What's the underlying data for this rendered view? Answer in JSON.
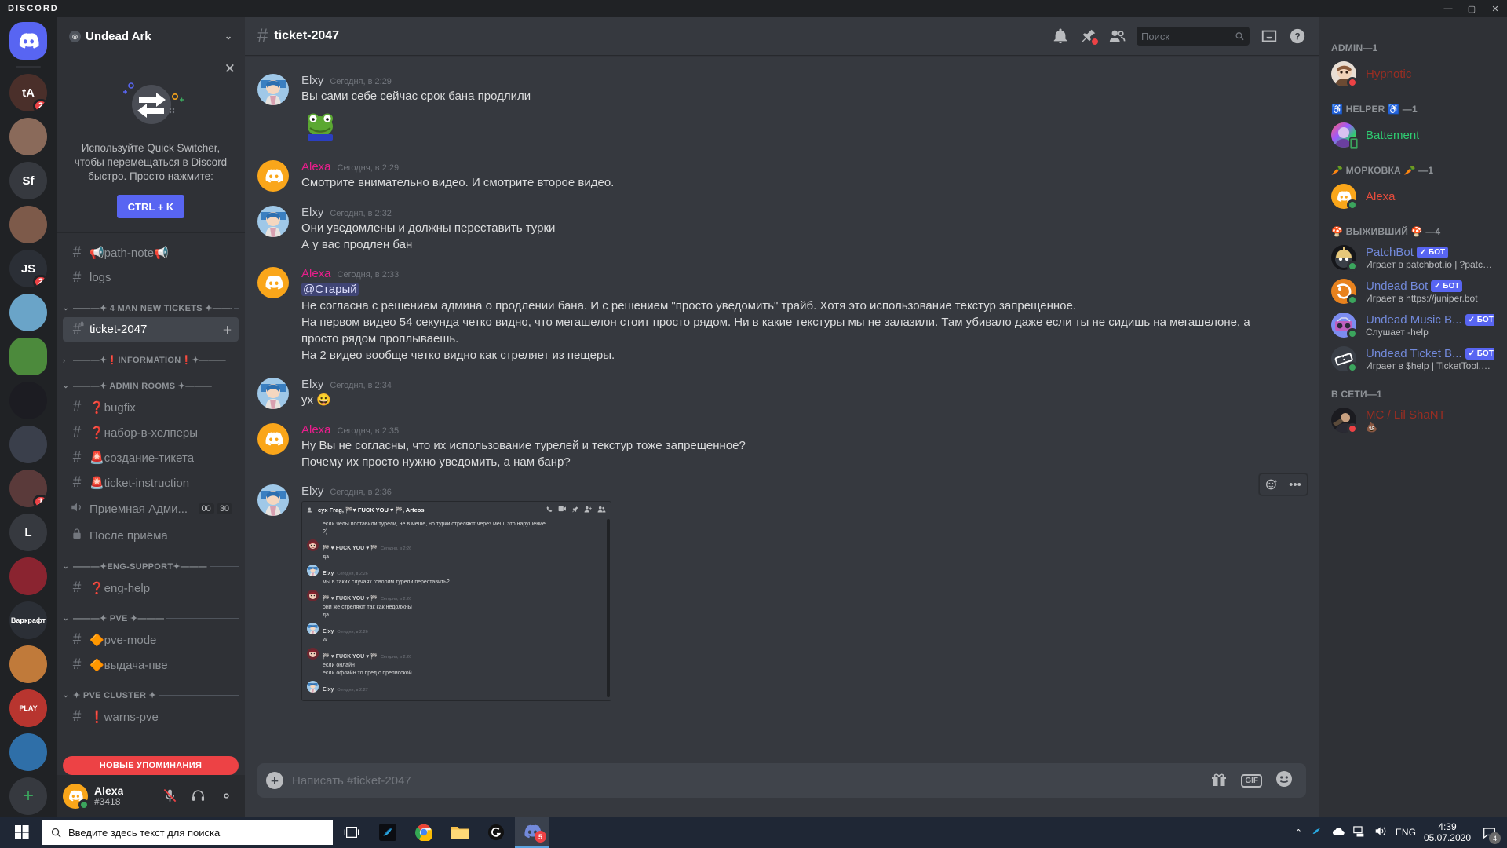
{
  "window": {
    "app_name": "DISCORD",
    "minimize": "—",
    "maximize": "▢",
    "close": "✕"
  },
  "guild_rail": {
    "home_label": "",
    "items": [
      {
        "name": "guild-undead-ark",
        "initials": "tA",
        "badge": "2",
        "selected": false,
        "color": "#4a2f2a"
      },
      {
        "name": "guild-anime",
        "initials": "",
        "badge": "",
        "selected": false,
        "color": "#8a6a5a"
      },
      {
        "name": "guild-sf",
        "initials": "Sf",
        "badge": "",
        "selected": false,
        "color": "#36393f"
      },
      {
        "name": "guild-photo",
        "initials": "",
        "badge": "",
        "selected": false,
        "color": "#7d5a4a"
      },
      {
        "name": "guild-js",
        "initials": "JS",
        "badge": "2",
        "selected": false,
        "color": "#2b2f36"
      },
      {
        "name": "guild-flower",
        "initials": "",
        "badge": "",
        "selected": false,
        "color": "#6aa4c8"
      },
      {
        "name": "guild-pepe",
        "initials": "",
        "badge": "",
        "selected": true,
        "color": "#4c8a3c"
      },
      {
        "name": "guild-dark",
        "initials": "",
        "badge": "",
        "selected": false,
        "color": "#1c1c22"
      },
      {
        "name": "guild-diamond",
        "initials": "",
        "badge": "",
        "selected": false,
        "color": "#3a3f4b"
      },
      {
        "name": "guild-skull",
        "initials": "",
        "badge": "1",
        "selected": false,
        "color": "#5a3a3a"
      },
      {
        "name": "guild-l",
        "initials": "L",
        "badge": "",
        "selected": false,
        "color": "#36393f"
      },
      {
        "name": "guild-red",
        "initials": "",
        "badge": "",
        "selected": false,
        "color": "#8a2430"
      },
      {
        "name": "guild-warcraft",
        "initials": "Варкрафт",
        "badge": "",
        "selected": false,
        "color": "#2b2f36"
      },
      {
        "name": "guild-orange",
        "initials": "",
        "badge": "",
        "selected": false,
        "color": "#c07a3a"
      },
      {
        "name": "guild-play",
        "initials": "PLAY",
        "badge": "",
        "selected": false,
        "color": "#b8352f"
      },
      {
        "name": "guild-spiral",
        "initials": "",
        "badge": "",
        "selected": false,
        "color": "#2f6fa8"
      }
    ],
    "add_server": "+"
  },
  "sidebar": {
    "guild_name": "Undead Ark",
    "chevron": "⌄",
    "promo": {
      "close": "✕",
      "text": "Используйте Quick Switcher, чтобы перемещаться в Discord быстро. Просто нажмите:",
      "button": "CTRL + K"
    },
    "groups": [
      {
        "name": "",
        "collapsed": false,
        "channels": [
          {
            "label": "📢path-note📢",
            "type": "text",
            "active": false,
            "locked": false
          },
          {
            "label": "logs",
            "type": "text",
            "active": false,
            "locked": false
          }
        ]
      },
      {
        "name": "———✦ 4 MAN NEW TICKETS ✦———",
        "collapsed": false,
        "channels": [
          {
            "label": "ticket-2047",
            "type": "text",
            "active": true,
            "locked": true,
            "action": "＋"
          }
        ]
      },
      {
        "name": "———✦❗INFORMATION❗✦———",
        "collapsed": true,
        "channels": []
      },
      {
        "name": "———✦ ADMIN ROOMS ✦———",
        "collapsed": false,
        "channels": [
          {
            "label": "❓bugfix",
            "type": "text",
            "active": false,
            "locked": false
          },
          {
            "label": "❓набор-в-хелперы",
            "type": "text",
            "active": false,
            "locked": false
          },
          {
            "label": "🚨создание-тикета",
            "type": "text",
            "active": false,
            "locked": false
          },
          {
            "label": "🚨ticket-instruction",
            "type": "text",
            "active": false,
            "locked": false
          },
          {
            "label": "Приемная Адми...",
            "type": "voice",
            "active": false,
            "counts": [
              "00",
              "30"
            ]
          },
          {
            "label": "После приёма",
            "type": "locked",
            "active": false
          }
        ]
      },
      {
        "name": "———✦ENG-SUPPORT✦———",
        "collapsed": false,
        "channels": [
          {
            "label": "❓eng-help",
            "type": "text",
            "active": false,
            "locked": false
          }
        ]
      },
      {
        "name": "———✦ PVE ✦———",
        "collapsed": false,
        "channels": [
          {
            "label": "🔶pve-mode",
            "type": "text",
            "active": false,
            "locked": false
          },
          {
            "label": "🔶выдача-пве",
            "type": "text",
            "active": false,
            "locked": false
          }
        ]
      },
      {
        "name": "✦ PVE CLUSTER ✦",
        "collapsed": false,
        "channels": [
          {
            "label": "❗warns-pve",
            "type": "text",
            "active": false,
            "locked": false
          }
        ]
      }
    ],
    "mention_banner": "НОВЫЕ УПОМИНАНИЯ",
    "user": {
      "name": "Alexa",
      "tag": "#3418",
      "mic_icon": "mic-muted-icon",
      "headset_icon": "headset-icon",
      "settings_icon": "gear-icon"
    }
  },
  "chat_header": {
    "channel": "ticket-2047",
    "icons": [
      "bell-icon",
      "pin-icon",
      "members-icon",
      "inbox-icon",
      "help-icon"
    ]
  },
  "search": {
    "placeholder": "Поиск",
    "value": "",
    "icon": "search-icon"
  },
  "messages": [
    {
      "author": "Elxy",
      "color": "#c7c9ce",
      "time": "Сегодня, в 2:29",
      "avatar": "elxy",
      "lines": [
        "Вы сами себе сейчас срок бана продлили"
      ],
      "sticker": "pepe"
    },
    {
      "author": "Alexa",
      "color": "#e91e8c",
      "time": "Сегодня, в 2:29",
      "avatar": "alexa",
      "lines": [
        "Смотрите внимательно видео. И смотрите второе видео."
      ]
    },
    {
      "author": "Elxy",
      "color": "#c7c9ce",
      "time": "Сегодня, в 2:32",
      "avatar": "elxy",
      "lines": [
        "Они уведомлены и должны переставить турки",
        "А у вас продлен бан"
      ]
    },
    {
      "author": "Alexa",
      "color": "#e91e8c",
      "time": "Сегодня, в 2:33",
      "avatar": "alexa",
      "mention": "@Старый",
      "lines": [
        "Не согласна с решением админа о продлении бана. И с решением \"просто уведомить\" трайб. Хотя это использование текстур запрещенное.",
        "На первом видео 54 секунда четко видно, что мегашелон стоит просто рядом. Ни в какие текстуры мы не залазили. Там убивало даже если ты не сидишь на мегашелоне, а просто рядом проплываешь.",
        "На 2 видео вообще четко видно как стреляет из пещеры."
      ]
    },
    {
      "author": "Elxy",
      "color": "#c7c9ce",
      "time": "Сегодня, в 2:34",
      "avatar": "elxy",
      "lines": [
        "ух 😀"
      ]
    },
    {
      "author": "Alexa",
      "color": "#e91e8c",
      "time": "Сегодня, в 2:35",
      "avatar": "alexa",
      "lines": [
        "Ну Вы не согласны, что их использование турелей и текстур тоже запрещенное?",
        "Почему их просто нужно уведомить, а нам банр?"
      ]
    },
    {
      "author": "Elxy",
      "color": "#c7c9ce",
      "time": "Сегодня, в 2:36",
      "avatar": "elxy",
      "lines": [],
      "has_embed": true
    }
  ],
  "hover_actions": {
    "react": "emoji-plus-icon",
    "more": "•••"
  },
  "embed": {
    "header_title": "cyx Frag, 🏁♥ FUCK YOU ♥ 🏁, Arteos",
    "header_icons": [
      "call-icon",
      "video-icon",
      "pin-icon",
      "add-user-icon",
      "members-icon"
    ],
    "messages": [
      {
        "author": "",
        "time": "",
        "avatar": "",
        "lines": [
          "если челы поставили турели,  не в меше, но турки стреляют через меш, это нарушение",
          "?)"
        ],
        "color": "#dcddde",
        "cont": true
      },
      {
        "author": "🏁 ♥ FUCK YOU ♥ 🏁",
        "time": "Сегодня, в 2:26",
        "avatar": "fy",
        "color": "#dcddde",
        "lines": [
          "да"
        ]
      },
      {
        "author": "Elxy",
        "time": "Сегодня, в 2:26",
        "avatar": "elxy",
        "color": "#dcddde",
        "lines": [
          "мы в таких случаях говорим турели переставить?"
        ]
      },
      {
        "author": "🏁 ♥ FUCK YOU ♥ 🏁",
        "time": "Сегодня, в 2:26",
        "avatar": "fy",
        "color": "#dcddde",
        "lines": [
          "они же стреляют так как недолжны",
          "да"
        ]
      },
      {
        "author": "Elxy",
        "time": "Сегодня, в 2:26",
        "avatar": "elxy",
        "color": "#dcddde",
        "lines": [
          "кк"
        ]
      },
      {
        "author": "🏁 ♥ FUCK YOU ♥ 🏁",
        "time": "Сегодня, в 2:26",
        "avatar": "fy",
        "color": "#dcddde",
        "lines": [
          "если онлайн",
          "если офлайн то пред с преписской"
        ]
      },
      {
        "author": "Elxy",
        "time": "Сегодня, в 2:27",
        "avatar": "elxy",
        "color": "#dcddde",
        "lines": []
      }
    ]
  },
  "composer": {
    "placeholder": "Написать #ticket-2047",
    "plus": "+",
    "icons": [
      "gift-icon",
      "GIF",
      "emoji-icon"
    ]
  },
  "members": {
    "groups": [
      {
        "title": "ADMIN—1",
        "people": [
          {
            "name": "Hypnotic",
            "color": "#992d22",
            "status": "dnd",
            "avatar": "hypnotic",
            "activity": "",
            "bot": false
          }
        ]
      },
      {
        "title": "♿ HELPER ♿ —1",
        "people": [
          {
            "name": "Battement",
            "color": "#2ecc71",
            "status": "mobile",
            "avatar": "battement",
            "activity": "",
            "bot": false
          }
        ]
      },
      {
        "title": "🥕 МОРКОВКА 🥕 —1",
        "people": [
          {
            "name": "Alexa",
            "color": "#e74c3c",
            "status": "online",
            "avatar": "alexa",
            "activity": "",
            "bot": false
          }
        ]
      },
      {
        "title": "🍄 ВЫЖИВШИЙ 🍄 —4",
        "people": [
          {
            "name": "PatchBot",
            "color": "#7289da",
            "status": "online",
            "avatar": "patchbot",
            "activity": "Играет в patchbot.io | ?patch...",
            "bot": true,
            "bot_label": "БОТ"
          },
          {
            "name": "Undead Bot",
            "color": "#7289da",
            "status": "online",
            "avatar": "undeadbot",
            "activity": "Играет в https://juniper.bot",
            "bot": true,
            "bot_label": "БОТ"
          },
          {
            "name": "Undead Music B...",
            "color": "#7289da",
            "status": "online",
            "avatar": "musicbot",
            "activity": "Слушает -help",
            "bot": true,
            "bot_label": "БОТ"
          },
          {
            "name": "Undead Ticket B...",
            "color": "#7289da",
            "status": "online",
            "avatar": "ticketbot",
            "activity": "Играет в $help | TicketTool.xy...",
            "bot": true,
            "bot_label": "БОТ"
          }
        ]
      },
      {
        "title": "В СЕТИ—1",
        "people": [
          {
            "name": "MC / Lil ShaNT",
            "color": "#992d22",
            "status": "dnd",
            "avatar": "mc",
            "activity": "💩",
            "bot": false
          }
        ]
      }
    ]
  },
  "taskbar": {
    "search_placeholder": "Введите здесь текст для поиска",
    "apps": [
      {
        "name": "task-view-icon",
        "active": false
      },
      {
        "name": "app-blue-icon",
        "active": false
      },
      {
        "name": "chrome-icon",
        "active": false
      },
      {
        "name": "explorer-icon",
        "active": false
      },
      {
        "name": "logitech-icon",
        "active": false
      },
      {
        "name": "discord-taskbar-icon",
        "active": true,
        "badge": "5"
      }
    ],
    "tray": {
      "chevron": "⌃",
      "lang": "ENG",
      "time": "4:39",
      "date": "05.07.2020",
      "notif_count": "4"
    }
  },
  "colors": {
    "brand": "#5865f2",
    "danger": "#ed4245",
    "online": "#3ba55d",
    "bg_primary": "#36393f",
    "bg_secondary": "#2f3136",
    "bg_tertiary": "#202225"
  }
}
